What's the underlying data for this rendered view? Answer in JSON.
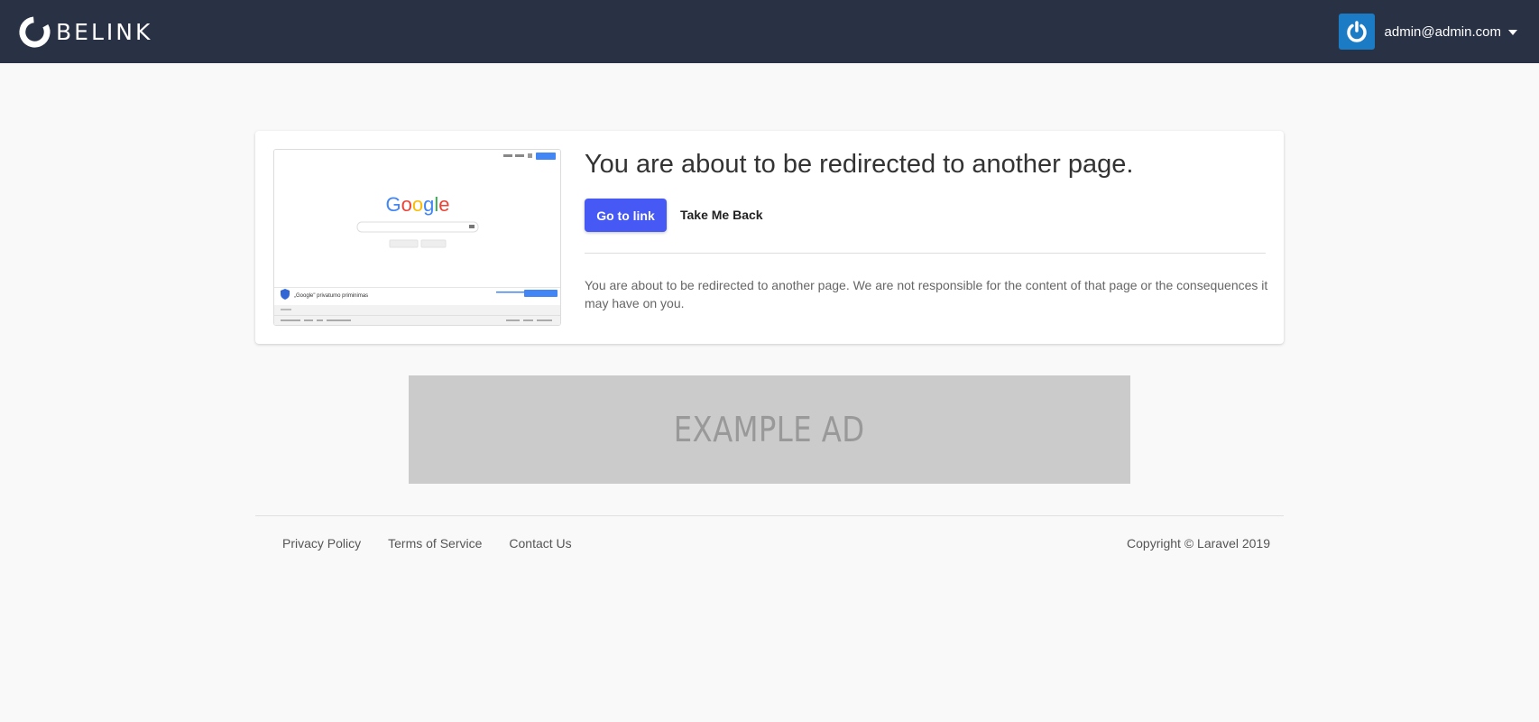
{
  "navbar": {
    "brand": "BELINK",
    "user_email": "admin@admin.com"
  },
  "redirect_card": {
    "title": "You are about to be redirected to another page.",
    "go_button": "Go to link",
    "back_button": "Take Me Back",
    "description": "You are about to be redirected to another page. We are not responsible for the content of that page or the consequences it may have on you."
  },
  "preview": {
    "logo_text": "Google",
    "search_button": "Google paieška",
    "lucky_button": "Man sekasi",
    "notice_text": "„Google\" privatumo priminimas",
    "signin_label": "Prisijungti"
  },
  "ad": {
    "text": "EXAMPLE AD"
  },
  "footer": {
    "links": [
      "Privacy Policy",
      "Terms of Service",
      "Contact Us"
    ],
    "copyright": "Copyright © Laravel 2019"
  },
  "colors": {
    "navbar_bg": "#293145",
    "primary_button": "#4659f5",
    "avatar_bg": "#1b7bc4",
    "page_bg": "#f9f9f9",
    "ad_bg": "#cbcbcb"
  }
}
